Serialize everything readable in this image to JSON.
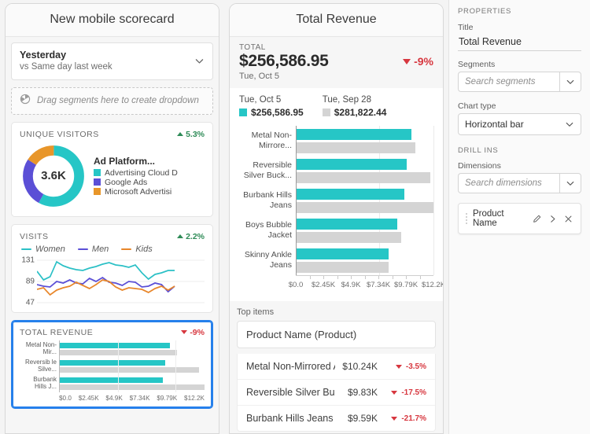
{
  "scorecard": {
    "title": "New mobile scorecard",
    "date_selector": {
      "main": "Yesterday",
      "sub": "vs Same day last week"
    },
    "drag_zone": {
      "text": "Drag segments here to create dropdown",
      "icon": "segment-icon"
    },
    "cards": [
      {
        "label": "UNIQUE VISITORS",
        "delta": "5.3%",
        "delta_dir": "up",
        "donut": {
          "center": "3.6K",
          "legend_title": "Ad Platform...",
          "slices": [
            {
              "name": "Advertising Cloud D",
              "color": "#26c6c6",
              "pct": 58
            },
            {
              "name": "Google Ads",
              "color": "#5b4fd6",
              "pct": 26
            },
            {
              "name": "Microsoft Advertisi",
              "color": "#e8962a",
              "pct": 16
            }
          ]
        }
      },
      {
        "label": "VISITS",
        "delta": "2.2%",
        "delta_dir": "up",
        "series_legend": [
          {
            "name": "Women",
            "color": "#2bc0c6"
          },
          {
            "name": "Men",
            "color": "#5b4fd6"
          },
          {
            "name": "Kids",
            "color": "#e8862a"
          }
        ],
        "y_ticks": [
          "131",
          "89",
          "47"
        ]
      },
      {
        "label": "TOTAL REVENUE",
        "delta": "-9%",
        "delta_dir": "down",
        "selected": true,
        "bars": [
          {
            "label": "Metal Non-Mir...",
            "current": 76,
            "previous": 81
          },
          {
            "label": "Reversib le Silve...",
            "current": 73,
            "previous": 96
          },
          {
            "label": "Burbank Hills J...",
            "current": 71,
            "previous": 100
          }
        ],
        "x_ticks": [
          "$0.0",
          "$2.45K",
          "$4.9K",
          "$7.34K",
          "$9.79K",
          "$12.2K"
        ]
      }
    ]
  },
  "revenue": {
    "title": "Total Revenue",
    "summary": {
      "label": "TOTAL",
      "value": "$256,586.95",
      "delta": "-9%",
      "delta_dir": "down",
      "date": "Tue, Oct 5"
    },
    "comparison": [
      {
        "date": "Tue, Oct 5",
        "value": "$256,586.95",
        "color": "#26c6c6"
      },
      {
        "date": "Tue, Sep 28",
        "value": "$281,822.44",
        "color": "#d4d4d4"
      }
    ],
    "chart_data": {
      "type": "bar",
      "title": "Total Revenue",
      "xlabel": "",
      "ylabel": "",
      "orientation": "horizontal",
      "categories": [
        "Metal Non-Mirrore...",
        "Reversible Silver Buck...",
        "Burbank Hills Jeans",
        "Boys Bubble Jacket",
        "Skinny Ankle Jeans"
      ],
      "series": [
        {
          "name": "Tue, Oct 5",
          "color": "#26c6c6",
          "values": [
            10.24,
            9.83,
            9.59,
            8.95,
            8.2
          ]
        },
        {
          "name": "Tue, Sep 28",
          "color": "#d4d4d4",
          "values": [
            10.61,
            11.92,
            12.2,
            9.31,
            8.2
          ]
        }
      ],
      "x_ticks": [
        "$0.0",
        "$2.45K",
        "$4.9K",
        "$7.34K",
        "$9.79K",
        "$12.2K"
      ],
      "xlim": [
        0,
        12.2
      ],
      "grid": true,
      "legend": "top"
    },
    "top_items": {
      "label": "Top items",
      "dimension": "Product Name (Product)",
      "rows": [
        {
          "name": "Metal Non-Mirrored Aviator",
          "value": "$10.24K",
          "delta": "-3.5%",
          "delta_dir": "down"
        },
        {
          "name": "Reversible Silver Buckle ...",
          "value": "$9.83K",
          "delta": "-17.5%",
          "delta_dir": "down"
        },
        {
          "name": "Burbank Hills Jeans",
          "value": "$9.59K",
          "delta": "-21.7%",
          "delta_dir": "down"
        }
      ]
    }
  },
  "properties": {
    "heading": "PROPERTIES",
    "title_label": "Title",
    "title_value": "Total Revenue",
    "segments_label": "Segments",
    "segments_placeholder": "Search segments",
    "chart_type_label": "Chart type",
    "chart_type_value": "Horizontal bar",
    "drill_ins_heading": "DRILL INS",
    "dimensions_label": "Dimensions",
    "dimensions_placeholder": "Search dimensions",
    "chip": {
      "name": "Product Name",
      "icons": [
        "pencil-icon",
        "chevron-right-icon",
        "close-icon"
      ]
    }
  },
  "colors": {
    "teal": "#26c6c6",
    "gray_bar": "#d4d4d4",
    "purple": "#5b4fd6",
    "orange": "#e8962a",
    "down_red": "#d7373f",
    "up_green": "#2e8b57",
    "accent_blue": "#2680eb"
  }
}
